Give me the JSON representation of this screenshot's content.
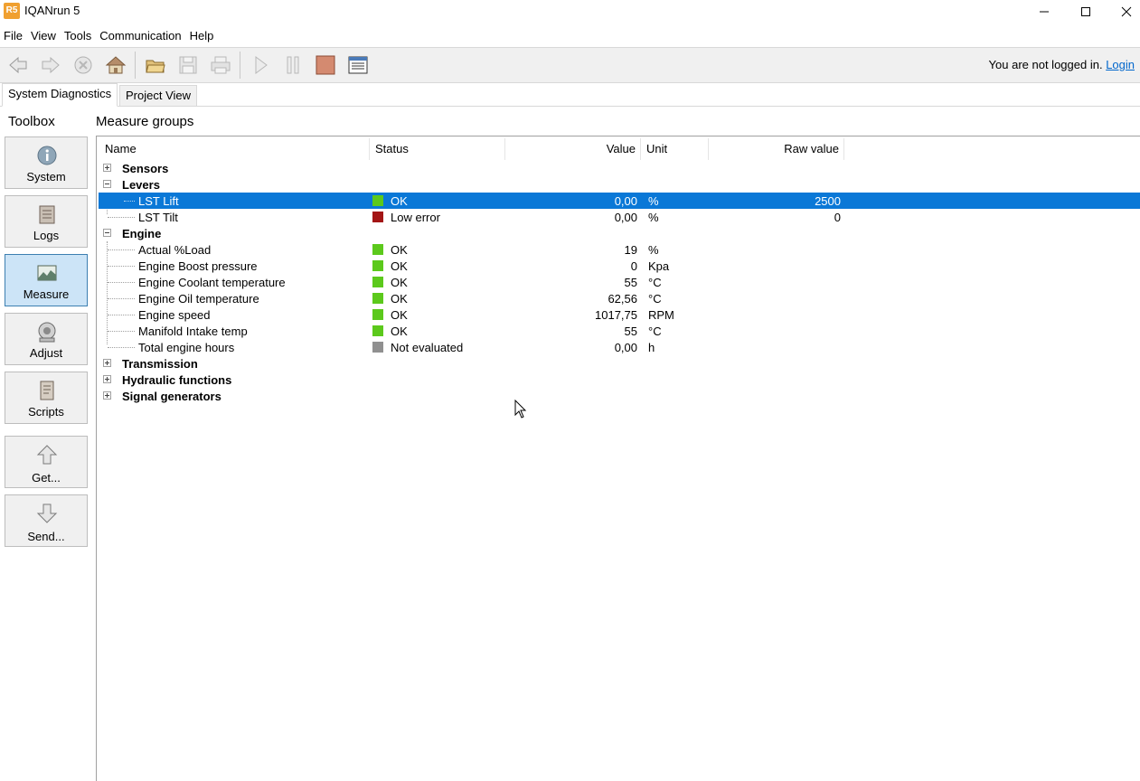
{
  "window": {
    "app_icon_text": "R5",
    "title": "IQANrun 5"
  },
  "menu": [
    "File",
    "View",
    "Tools",
    "Communication",
    "Help"
  ],
  "login": {
    "status": "You are not logged in.",
    "link": "Login"
  },
  "tabs": [
    "System Diagnostics",
    "Project View"
  ],
  "toolbox": {
    "title": "Toolbox",
    "items": [
      "System",
      "Logs",
      "Measure",
      "Adjust",
      "Scripts",
      "Get...",
      "Send..."
    ]
  },
  "main": {
    "title": "Measure groups",
    "columns": {
      "name": "Name",
      "status": "Status",
      "value": "Value",
      "unit": "Unit",
      "raw": "Raw value"
    },
    "groups": {
      "sensors": "Sensors",
      "levers": "Levers",
      "engine": "Engine",
      "transmission": "Transmission",
      "hydraulic": "Hydraulic functions",
      "signal": "Signal generators"
    },
    "levers": [
      {
        "name": "LST Lift",
        "status": "OK",
        "value": "0,00",
        "unit": "%",
        "raw": "2500"
      },
      {
        "name": "LST Tilt",
        "status": "Low error",
        "value": "0,00",
        "unit": "%",
        "raw": "0"
      }
    ],
    "engine": [
      {
        "name": "Actual %Load",
        "status": "OK",
        "value": "19",
        "unit": "%"
      },
      {
        "name": "Engine Boost pressure",
        "status": "OK",
        "value": "0",
        "unit": "Kpa"
      },
      {
        "name": "Engine Coolant temperature",
        "status": "OK",
        "value": "55",
        "unit": "°C"
      },
      {
        "name": "Engine Oil temperature",
        "status": "OK",
        "value": "62,56",
        "unit": "°C"
      },
      {
        "name": "Engine speed",
        "status": "OK",
        "value": "1017,75",
        "unit": "RPM"
      },
      {
        "name": "Manifold Intake temp",
        "status": "OK",
        "value": "55",
        "unit": "°C"
      },
      {
        "name": "Total engine hours",
        "status": "Not evaluated",
        "value": "0,00",
        "unit": "h"
      }
    ]
  },
  "colors": {
    "ok": "#5cc91c",
    "error": "#a31515",
    "not_evaluated": "#909090",
    "selection": "#0a78d7"
  }
}
